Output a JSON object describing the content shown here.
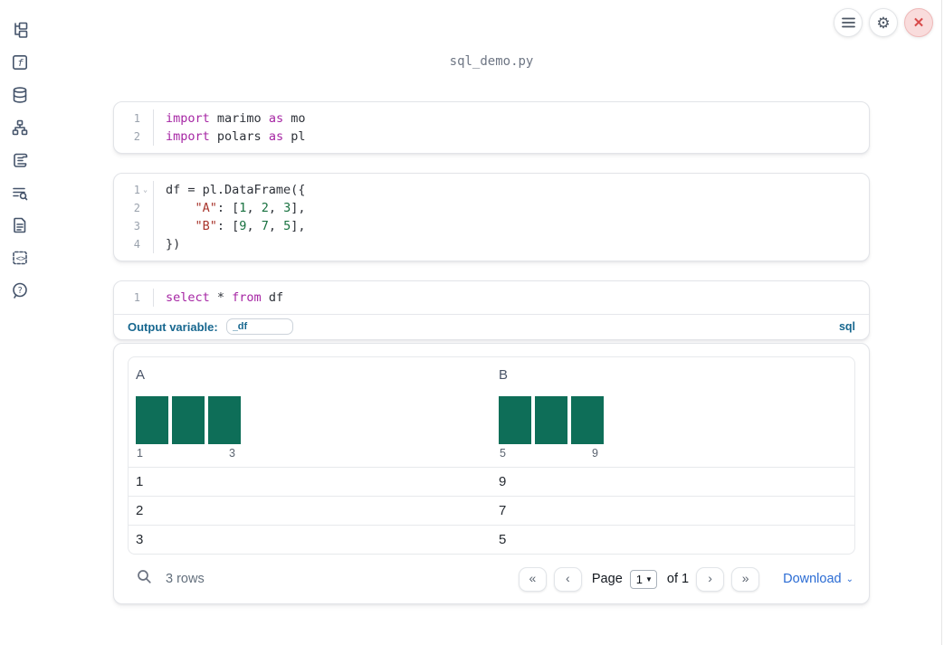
{
  "window": {
    "title": "sql_demo.py",
    "topbar_icons": [
      "menu-icon",
      "gear-icon",
      "close-icon"
    ]
  },
  "sidebar": {
    "items": [
      {
        "icon": "file-explorer-icon"
      },
      {
        "icon": "functions-icon"
      },
      {
        "icon": "database-icon"
      },
      {
        "icon": "dependency-graph-icon"
      },
      {
        "icon": "logs-scroll-icon"
      },
      {
        "icon": "search-list-icon"
      },
      {
        "icon": "document-icon"
      },
      {
        "icon": "snippets-icon"
      },
      {
        "icon": "help-icon"
      }
    ]
  },
  "cells": [
    {
      "type": "python",
      "lines": [
        {
          "num": "1",
          "fold": false,
          "tokens": [
            [
              "kw",
              "import"
            ],
            [
              "pl",
              " marimo "
            ],
            [
              "kw",
              "as"
            ],
            [
              "pl",
              " mo"
            ]
          ]
        },
        {
          "num": "2",
          "fold": false,
          "tokens": [
            [
              "kw",
              "import"
            ],
            [
              "pl",
              " polars "
            ],
            [
              "kw",
              "as"
            ],
            [
              "pl",
              " pl"
            ]
          ]
        }
      ]
    },
    {
      "type": "python",
      "lines": [
        {
          "num": "1",
          "fold": true,
          "tokens": [
            [
              "pl",
              "df = pl.DataFrame({"
            ]
          ]
        },
        {
          "num": "2",
          "fold": false,
          "tokens": [
            [
              "pl",
              "    "
            ],
            [
              "str",
              "\"A\""
            ],
            [
              "pl",
              ": ["
            ],
            [
              "num",
              "1"
            ],
            [
              "pl",
              ", "
            ],
            [
              "num",
              "2"
            ],
            [
              "pl",
              ", "
            ],
            [
              "num",
              "3"
            ],
            [
              "pl",
              "],"
            ]
          ]
        },
        {
          "num": "3",
          "fold": false,
          "tokens": [
            [
              "pl",
              "    "
            ],
            [
              "str",
              "\"B\""
            ],
            [
              "pl",
              ": ["
            ],
            [
              "num",
              "9"
            ],
            [
              "pl",
              ", "
            ],
            [
              "num",
              "7"
            ],
            [
              "pl",
              ", "
            ],
            [
              "num",
              "5"
            ],
            [
              "pl",
              "],"
            ]
          ]
        },
        {
          "num": "4",
          "fold": false,
          "tokens": [
            [
              "pl",
              "})"
            ]
          ]
        }
      ]
    },
    {
      "type": "sql",
      "lines": [
        {
          "num": "1",
          "fold": false,
          "tokens": [
            [
              "kw",
              "select"
            ],
            [
              "pl",
              " * "
            ],
            [
              "kw",
              "from"
            ],
            [
              "pl",
              " df"
            ]
          ]
        }
      ],
      "output_variable_label": "Output variable:",
      "output_variable_value": "_df",
      "language_label": "sql"
    }
  ],
  "table": {
    "columns": [
      {
        "name": "A",
        "histogram": {
          "bar_count": 3,
          "min_label": "1",
          "max_label": "3"
        }
      },
      {
        "name": "B",
        "histogram": {
          "bar_count": 3,
          "min_label": "5",
          "max_label": "9"
        }
      }
    ],
    "rows": [
      [
        "1",
        "9"
      ],
      [
        "2",
        "7"
      ],
      [
        "3",
        "5"
      ]
    ],
    "footer": {
      "row_count": "3 rows",
      "pagination": {
        "first_label": "«",
        "prev_label": "‹",
        "page_label": "Page",
        "page_value": "1",
        "of_label": "of 1",
        "next_label": "›",
        "last_label": "»"
      },
      "download_label": "Download"
    }
  },
  "colors": {
    "keyword": "#a626a4",
    "string": "#a8352c",
    "number": "#17713f",
    "accent_teal_blue": "#17678f",
    "link_blue": "#2b6cd4",
    "histogram_bar": "#0e6e58",
    "close_red": "#d84b4b"
  }
}
